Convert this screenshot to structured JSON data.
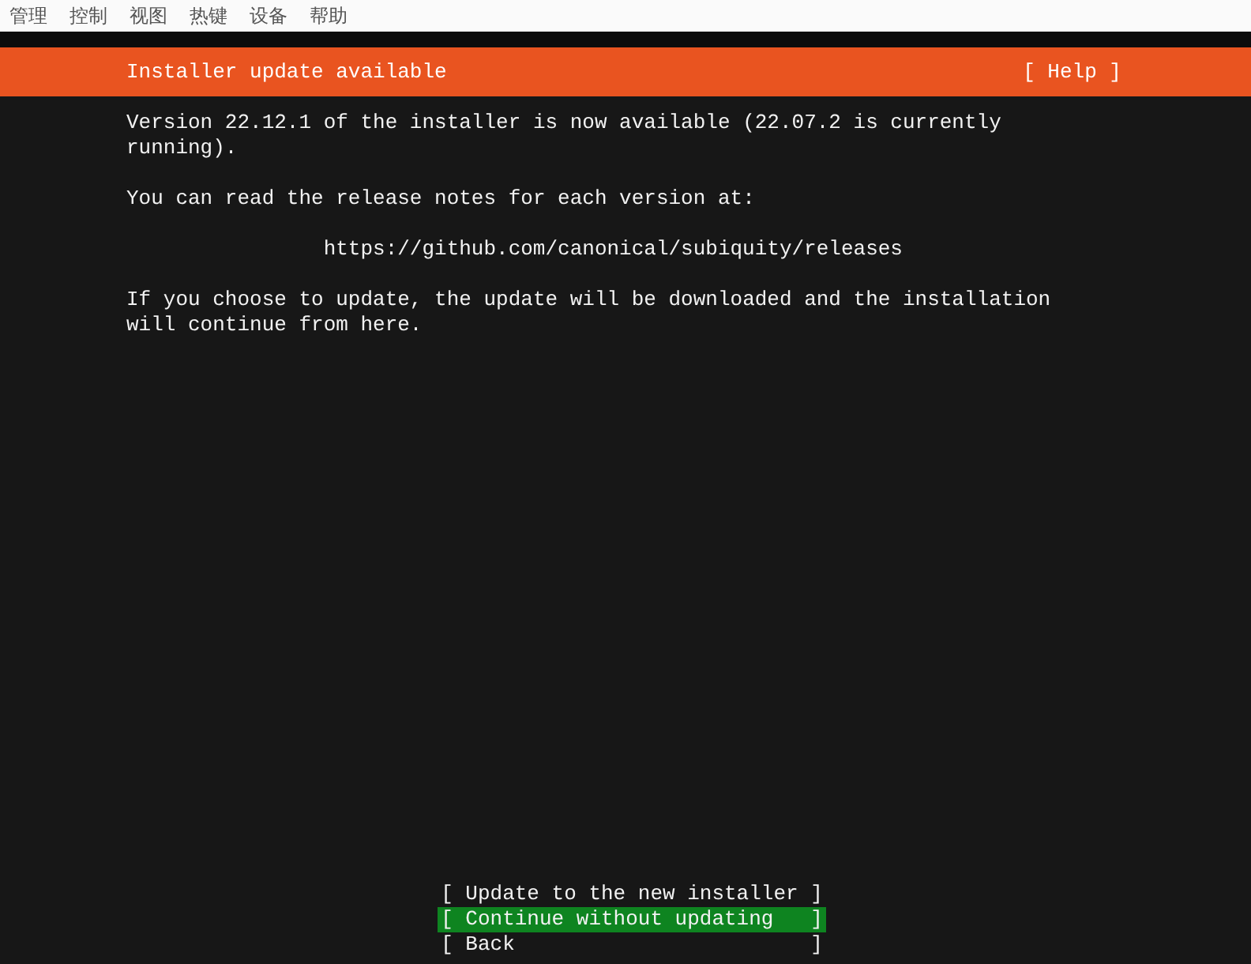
{
  "menu_bar": [
    "管理",
    "控制",
    "视图",
    "热键",
    "设备",
    "帮助"
  ],
  "header": {
    "title": "Installer update available",
    "help": "[ Help ]"
  },
  "paragraphs": [
    {
      "kind": "text",
      "text": "Version 22.12.1 of the installer is now available (22.07.2 is currently running)."
    },
    {
      "kind": "text",
      "text": "You can read the release notes for each version at:"
    },
    {
      "kind": "link",
      "text": "https://github.com/canonical/subiquity/releases"
    },
    {
      "kind": "text",
      "text": "If you choose to update, the update will be downloaded and the installation will continue from here."
    }
  ],
  "buttons": [
    {
      "label": "[ Update to the new installer ]",
      "selected": false
    },
    {
      "label": "[ Continue without updating   ]",
      "selected": true
    },
    {
      "label": "[ Back                        ]",
      "selected": false
    }
  ]
}
